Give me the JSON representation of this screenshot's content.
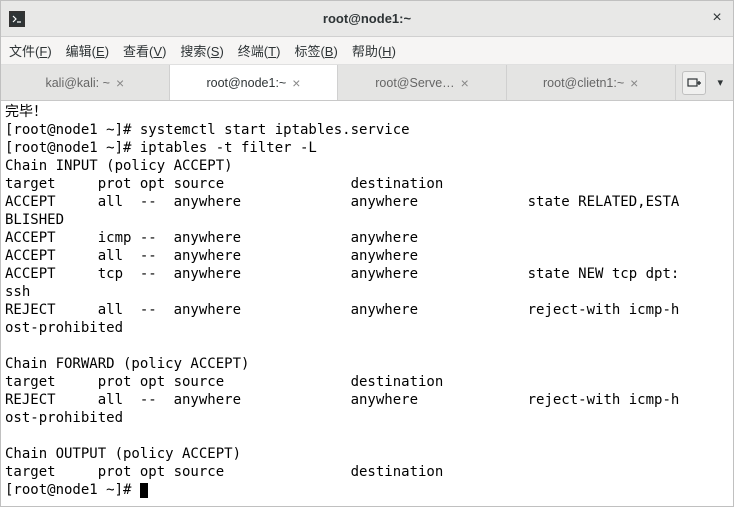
{
  "window": {
    "title": "root@node1:~"
  },
  "menubar": {
    "items": [
      {
        "label": "文件",
        "mnemonic": "F"
      },
      {
        "label": "编辑",
        "mnemonic": "E"
      },
      {
        "label": "查看",
        "mnemonic": "V"
      },
      {
        "label": "搜索",
        "mnemonic": "S"
      },
      {
        "label": "终端",
        "mnemonic": "T"
      },
      {
        "label": "标签",
        "mnemonic": "B"
      },
      {
        "label": "帮助",
        "mnemonic": "H"
      }
    ]
  },
  "tabs": [
    {
      "label": "kali@kali: ~",
      "active": false
    },
    {
      "label": "root@node1:~",
      "active": true
    },
    {
      "label": "root@Serve…",
      "active": false
    },
    {
      "label": "root@clietn1:~",
      "active": false
    }
  ],
  "terminal": {
    "lines": [
      "完毕！",
      "[root@node1 ~]# systemctl start iptables.service",
      "[root@node1 ~]# iptables -t filter -L",
      "Chain INPUT (policy ACCEPT)",
      "target     prot opt source               destination",
      "ACCEPT     all  --  anywhere             anywhere             state RELATED,ESTA",
      "BLISHED",
      "ACCEPT     icmp --  anywhere             anywhere",
      "ACCEPT     all  --  anywhere             anywhere",
      "ACCEPT     tcp  --  anywhere             anywhere             state NEW tcp dpt:",
      "ssh",
      "REJECT     all  --  anywhere             anywhere             reject-with icmp-h",
      "ost-prohibited",
      "",
      "Chain FORWARD (policy ACCEPT)",
      "target     prot opt source               destination",
      "REJECT     all  --  anywhere             anywhere             reject-with icmp-h",
      "ost-prohibited",
      "",
      "Chain OUTPUT (policy ACCEPT)",
      "target     prot opt source               destination",
      "[root@node1 ~]# "
    ]
  }
}
